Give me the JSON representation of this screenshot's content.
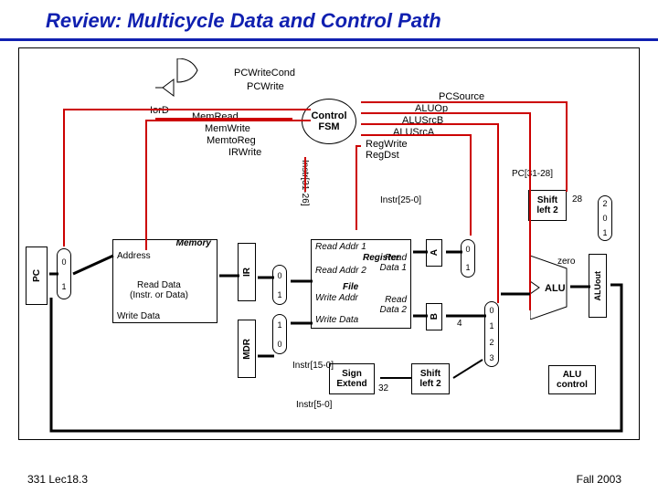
{
  "title": "Review:  Multicycle Data and Control Path",
  "footer": {
    "left": "331 Lec18.3",
    "right": "Fall 2003"
  },
  "control_signals": {
    "pcwritecond": "PCWriteCond",
    "pcwrite": "PCWrite",
    "iord": "IorD",
    "memread": "MemRead",
    "memwrite": "MemWrite",
    "memtoreg": "MemtoReg",
    "irwrite": "IRWrite",
    "pcsource": "PCSource",
    "aluop": "ALUOp",
    "alusrcb": "ALUSrcB",
    "alusrca": "ALUSrcA",
    "regwrite": "RegWrite",
    "regdst": "RegDst",
    "instr3126": "Instr[31-26]",
    "instr250": "Instr[25-0]",
    "instr150": "Instr[15-0]",
    "instr50": "Instr[5-0]",
    "pc3128": "PC[31-28]",
    "n28": "28",
    "n32": "32",
    "n4": "4"
  },
  "blocks": {
    "pc": "PC",
    "memory": {
      "title": "Memory",
      "address": "Address",
      "read_data": "Read Data\n(Instr. or Data)",
      "write_data": "Write Data"
    },
    "ir": "IR",
    "mdr": "MDR",
    "regfile": {
      "read_addr1": "Read Addr 1",
      "register": "Register",
      "read_addr2": "Read Addr 2",
      "file": "File",
      "write_addr": "Write Addr",
      "write_data": "Write Data",
      "read_data1": "Read\nData 1",
      "read_data2": "Read\nData 2"
    },
    "a": "A",
    "b": "B",
    "aluout": "ALUout",
    "sign_extend": "Sign\nExtend",
    "shift_left_2": "Shift\nleft 2",
    "alu": "ALU",
    "zero": "zero",
    "alu_control": "ALU\ncontrol",
    "control_fsm": "Control\nFSM"
  },
  "mux_labels": {
    "m0": "0",
    "m1": "1",
    "m2": "2",
    "m3": "3"
  }
}
